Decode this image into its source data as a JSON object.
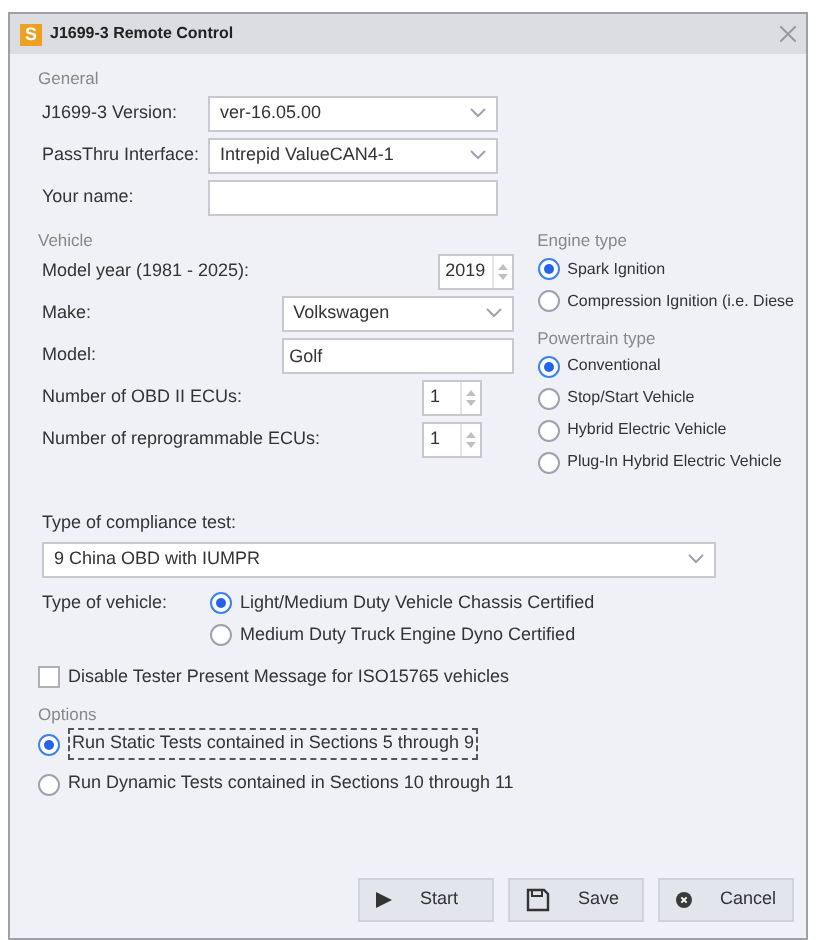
{
  "window": {
    "title": "J1699-3 Remote Control",
    "app_icon": "S"
  },
  "general": {
    "heading": "General",
    "version": {
      "label": "J1699-3 Version:",
      "value": "ver-16.05.00"
    },
    "passthru": {
      "label": "PassThru Interface:",
      "value": "Intrepid ValueCAN4-1"
    },
    "name": {
      "label": "Your name:"
    }
  },
  "vehicle": {
    "heading": "Vehicle",
    "model_year": {
      "label": "Model year (1981 - 2025):",
      "value": "2019"
    },
    "make": {
      "label": "Make:",
      "value": "Volkswagen"
    },
    "model": {
      "label": "Model:",
      "value": "Golf"
    },
    "obd_ecus": {
      "label": "Number of OBD II ECUs:",
      "value": "1"
    },
    "reprog_ecus": {
      "label": "Number of reprogrammable ECUs:",
      "value": "1"
    }
  },
  "engine_type": {
    "heading": "Engine type",
    "options": [
      {
        "label": "Spark Ignition",
        "selected": true
      },
      {
        "label": "Compression Ignition (i.e. Diese",
        "selected": false
      }
    ]
  },
  "powertrain_type": {
    "heading": "Powertrain type",
    "options": [
      {
        "label": "Conventional",
        "selected": true
      },
      {
        "label": "Stop/Start Vehicle",
        "selected": false
      },
      {
        "label": "Hybrid Electric Vehicle",
        "selected": false
      },
      {
        "label": "Plug-In Hybrid Electric Vehicle",
        "selected": false
      }
    ]
  },
  "compliance": {
    "label": "Type of compliance test:",
    "value": "9  China OBD with IUMPR"
  },
  "vehicle_type": {
    "label": "Type of vehicle:",
    "options": [
      {
        "label": "Light/Medium Duty Vehicle Chassis Certified",
        "selected": true
      },
      {
        "label": "Medium Duty Truck Engine Dyno Certified",
        "selected": false
      }
    ]
  },
  "disable_tester": {
    "label": "Disable Tester Present Message for ISO15765 vehicles",
    "checked": false
  },
  "options": {
    "heading": "Options",
    "items": [
      {
        "label": "Run Static Tests contained in Sections 5 through 9",
        "selected": true
      },
      {
        "label": "Run Dynamic Tests contained in Sections 10 through 11",
        "selected": false
      }
    ]
  },
  "buttons": [
    {
      "kind": "start",
      "label": "Start"
    },
    {
      "kind": "save",
      "label": "Save"
    },
    {
      "kind": "cancel",
      "label": "Cancel"
    }
  ]
}
